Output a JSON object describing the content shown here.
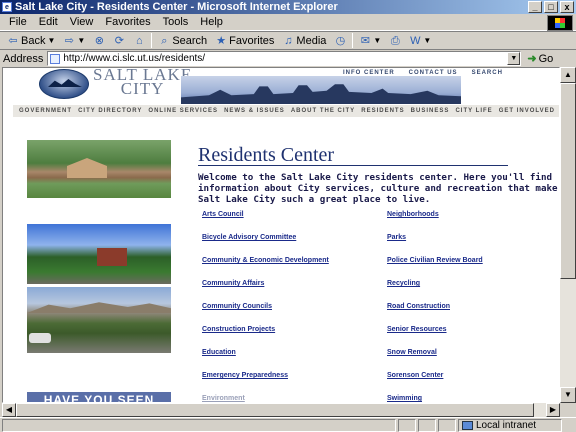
{
  "window": {
    "title": "Salt Lake City - Residents Center - Microsoft Internet Explorer",
    "controls": [
      "_",
      "□",
      "x"
    ]
  },
  "menu": [
    "File",
    "Edit",
    "View",
    "Favorites",
    "Tools",
    "Help"
  ],
  "toolbar": {
    "back": "Back",
    "search": "Search",
    "favorites": "Favorites",
    "media": "Media"
  },
  "address": {
    "label": "Address",
    "url": "http://www.ci.slc.ut.us/residents/",
    "go": "Go"
  },
  "site": {
    "logo_line1": "SALT LAKE",
    "logo_line2": "CITY",
    "top_links": [
      "INFO CENTER",
      "CONTACT US",
      "SEARCH"
    ],
    "nav": [
      "GOVERNMENT",
      "CITY DIRECTORY",
      "ONLINE SERVICES",
      "NEWS & ISSUES",
      "ABOUT THE CITY",
      "RESIDENTS",
      "BUSINESS",
      "CITY LIFE",
      "GET INVOLVED"
    ]
  },
  "page": {
    "title": "Residents Center",
    "intro": "Welcome to the Salt Lake City residents center. Here you'll find information about City services, culture and recreation that make Salt Lake City such a great place to live.",
    "banner": "HAVE YOU SEEN",
    "links_col1": [
      "Arts Council",
      "Bicycle Advisory Committee",
      "Community & Economic Development",
      "Community Affairs",
      "Community Councils",
      "Construction Projects",
      "Education",
      "Emergency Preparedness",
      "Environment"
    ],
    "links_col2": [
      "Neighborhoods",
      "Parks",
      "Police Civilian Review Board",
      "Recycling",
      "Road Construction",
      "Senior Resources",
      "Snow Removal",
      "Sorenson Center",
      "Swimming"
    ]
  },
  "status": {
    "text": "",
    "zone": "Local intranet"
  }
}
